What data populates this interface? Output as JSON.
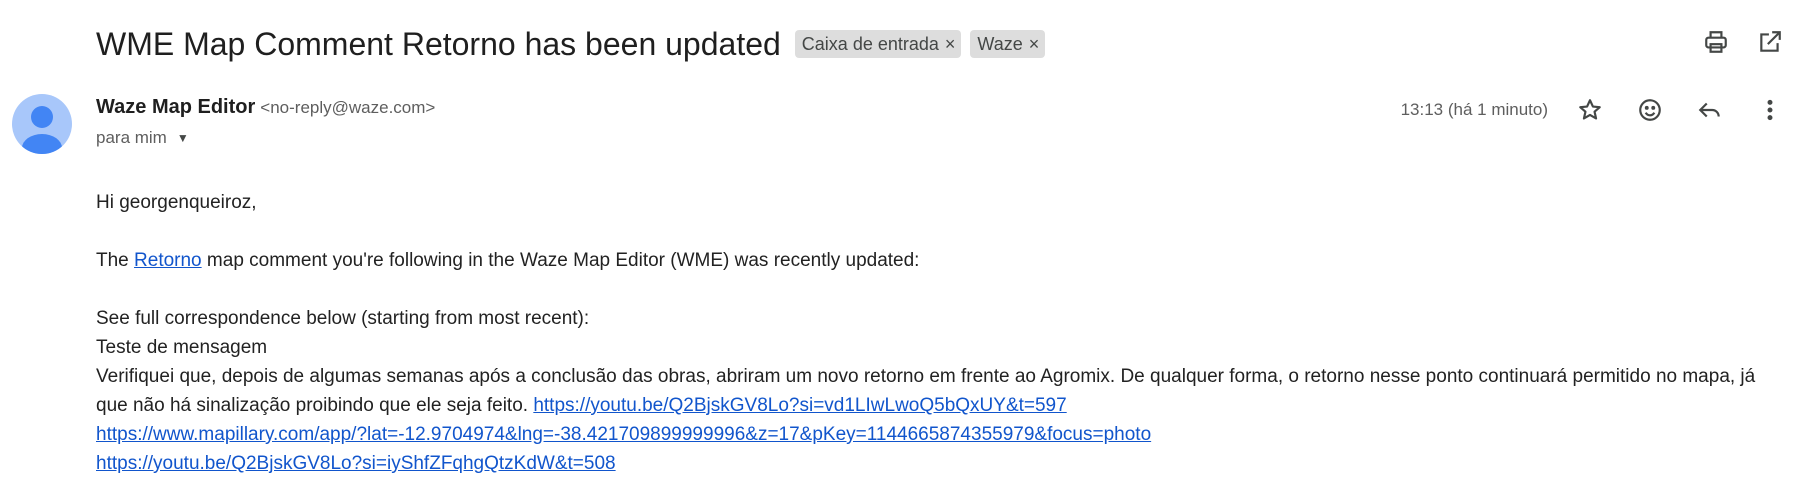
{
  "email": {
    "subject": "WME Map Comment Retorno has been updated",
    "labels": [
      {
        "name": "Caixa de entrada",
        "remove": "×"
      },
      {
        "name": "Waze",
        "remove": "×"
      }
    ],
    "sender_name": "Waze Map Editor",
    "sender_email": "<no-reply@waze.com>",
    "recipient": "para mim",
    "timestamp": "13:13 (há 1 minuto)"
  },
  "icons": {
    "print": "printer-icon",
    "open_new_window": "open-in-new-window-icon",
    "star": "star-icon",
    "emoji": "smiley-icon",
    "reply": "reply-icon",
    "more": "more-vertical-icon",
    "dropdown": "caret-down-icon",
    "avatar": "person-avatar-icon"
  },
  "colors": {
    "avatar_bg": "#a8c7fa",
    "avatar_fg": "#4285f4",
    "link": "#1155cc",
    "chip_bg": "#dddddd"
  },
  "body": {
    "greeting": "Hi georgenqueiroz,",
    "line1_before": "The ",
    "line1_link": "Retorno",
    "line1_after": " map comment you're following in the Waze Map Editor (WME) was recently updated:",
    "see_full": "See full correspondence below (starting from most recent):",
    "message_title": "Teste de mensagem",
    "message_text": "Verifiquei que, depois de algumas semanas após a conclusão das obras, abriram um novo retorno em frente ao Agromix. De qualquer forma, o retorno nesse ponto continuará permitido no mapa, já que não há sinalização proibindo que ele seja feito. ",
    "link1": "https://youtu.be/Q2BjskGV8Lo?si=vd1LIwLwoQ5bQxUY&t=597",
    "link2": "https://www.mapillary.com/app/?lat=-12.9704974&lng=-38.421709899999996&z=17&pKey=1144665874355979&focus=photo",
    "link3": "https://youtu.be/Q2BjskGV8Lo?si=iyShfZFqhgQtzKdW&t=508"
  }
}
